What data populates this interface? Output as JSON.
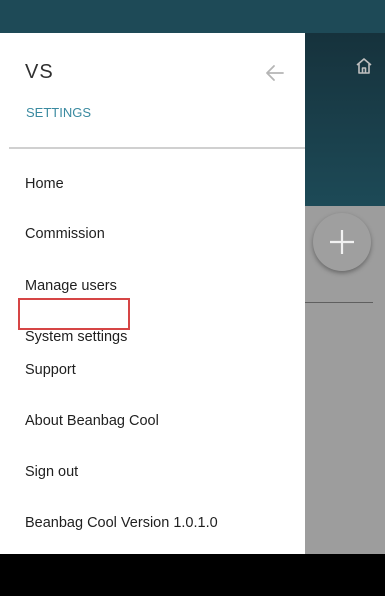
{
  "drawer": {
    "title": "VS",
    "subtitle": "SETTINGS",
    "items": [
      {
        "label": "Home"
      },
      {
        "label": "Commission"
      },
      {
        "label": "Manage users",
        "highlighted": true
      },
      {
        "label": "System settings"
      },
      {
        "label": "Support"
      },
      {
        "label": "About Beanbag Cool"
      },
      {
        "label": "Sign out"
      },
      {
        "label": "Beanbag Cool Version 1.0.1.0"
      }
    ]
  },
  "icons": {
    "back": "arrow-left-icon",
    "home": "home-icon",
    "add": "plus-icon"
  },
  "colors": {
    "accent": "#3a8aa0",
    "header_dark": "#1e4a57",
    "highlight": "#d64545"
  }
}
